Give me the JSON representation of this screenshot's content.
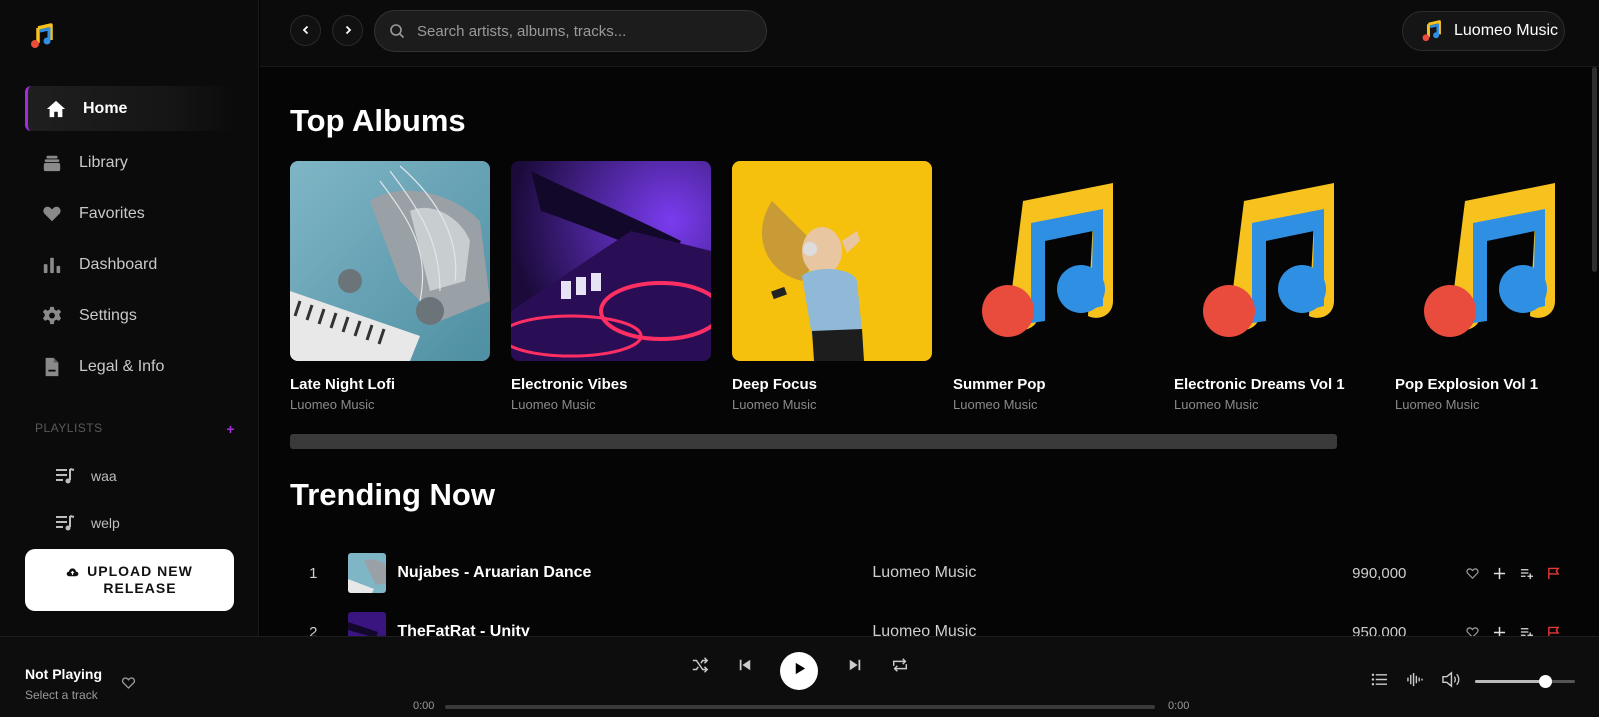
{
  "sidebar": {
    "nav": [
      {
        "label": "Home",
        "icon": "home-icon",
        "active": true
      },
      {
        "label": "Library",
        "icon": "library-icon",
        "active": false
      },
      {
        "label": "Favorites",
        "icon": "heart-icon",
        "active": false
      },
      {
        "label": "Dashboard",
        "icon": "bar-chart-icon",
        "active": false
      },
      {
        "label": "Settings",
        "icon": "gear-icon",
        "active": false
      },
      {
        "label": "Legal & Info",
        "icon": "document-icon",
        "active": false
      }
    ],
    "playlists_heading": "PLAYLISTS",
    "playlists_add": "+",
    "playlists": [
      {
        "label": "waa"
      },
      {
        "label": "welp"
      }
    ],
    "upload_label_line1": "UPLOAD NEW",
    "upload_label_line2": "RELEASE"
  },
  "topbar": {
    "search_placeholder": "Search artists, albums, tracks...",
    "profile_name": "Luomeo Music"
  },
  "main": {
    "top_albums_heading": "Top Albums",
    "albums": [
      {
        "title": "Late Night Lofi",
        "artist": "Luomeo Music",
        "art": "robot-keyboard"
      },
      {
        "title": "Electronic Vibes",
        "artist": "Luomeo Music",
        "art": "dj-purple"
      },
      {
        "title": "Deep Focus",
        "artist": "Luomeo Music",
        "art": "woman-headphones"
      },
      {
        "title": "Summer Pop",
        "artist": "Luomeo Music",
        "art": "music-note-logo"
      },
      {
        "title": "Electronic Dreams Vol 1",
        "artist": "Luomeo Music",
        "art": "music-note-logo"
      },
      {
        "title": "Pop Explosion Vol 1",
        "artist": "Luomeo Music",
        "art": "music-note-logo"
      }
    ],
    "trending_heading": "Trending Now",
    "tracks": [
      {
        "num": "1",
        "name": "Nujabes - Aruarian Dance",
        "artist": "Luomeo Music",
        "plays": "990,000"
      },
      {
        "num": "2",
        "name": "TheFatRat - Unity",
        "artist": "Luomeo Music",
        "plays": "950,000"
      }
    ]
  },
  "player": {
    "title": "Not Playing",
    "subtitle": "Select a track",
    "time_current": "0:00",
    "time_total": "0:00",
    "volume": 0.7
  },
  "colors": {
    "accent": "#a42be0",
    "flag": "#e53935",
    "note_yellow": "#f7c21d",
    "note_blue": "#2f8fe3",
    "note_red": "#e94b3c"
  }
}
